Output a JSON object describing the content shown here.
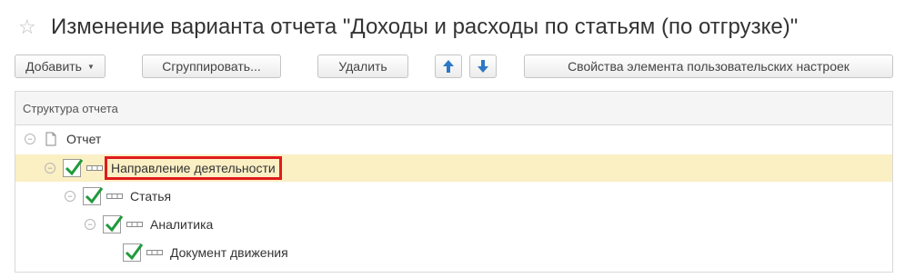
{
  "window": {
    "favorite_icon": "star-icon",
    "title": "Изменение варианта отчета \"Доходы и расходы по статьям (по отгрузке)\""
  },
  "toolbar": {
    "add_label": "Добавить",
    "group_label": "Сгруппировать...",
    "delete_label": "Удалить",
    "move_up_icon": "arrow-up-icon",
    "move_down_icon": "arrow-down-icon",
    "properties_label": "Свойства элемента пользовательских настроек"
  },
  "structure": {
    "header": "Структура отчета",
    "nodes": [
      {
        "label": "Отчет",
        "icon": "document-icon",
        "checked": null,
        "selected": false
      },
      {
        "label": "Направление деятельности",
        "icon": "grouping-field-icon",
        "checked": true,
        "selected": true
      },
      {
        "label": "Статья",
        "icon": "grouping-field-icon",
        "checked": true,
        "selected": false
      },
      {
        "label": "Аналитика",
        "icon": "grouping-field-icon",
        "checked": true,
        "selected": false
      },
      {
        "label": "Документ движения",
        "icon": "grouping-field-icon",
        "checked": true,
        "selected": false
      }
    ]
  },
  "colors": {
    "selected_row": "#fbefc4",
    "highlight_border": "#e01b1b",
    "checkmark": "#1f9a3c",
    "arrow": "#2c78c6"
  }
}
